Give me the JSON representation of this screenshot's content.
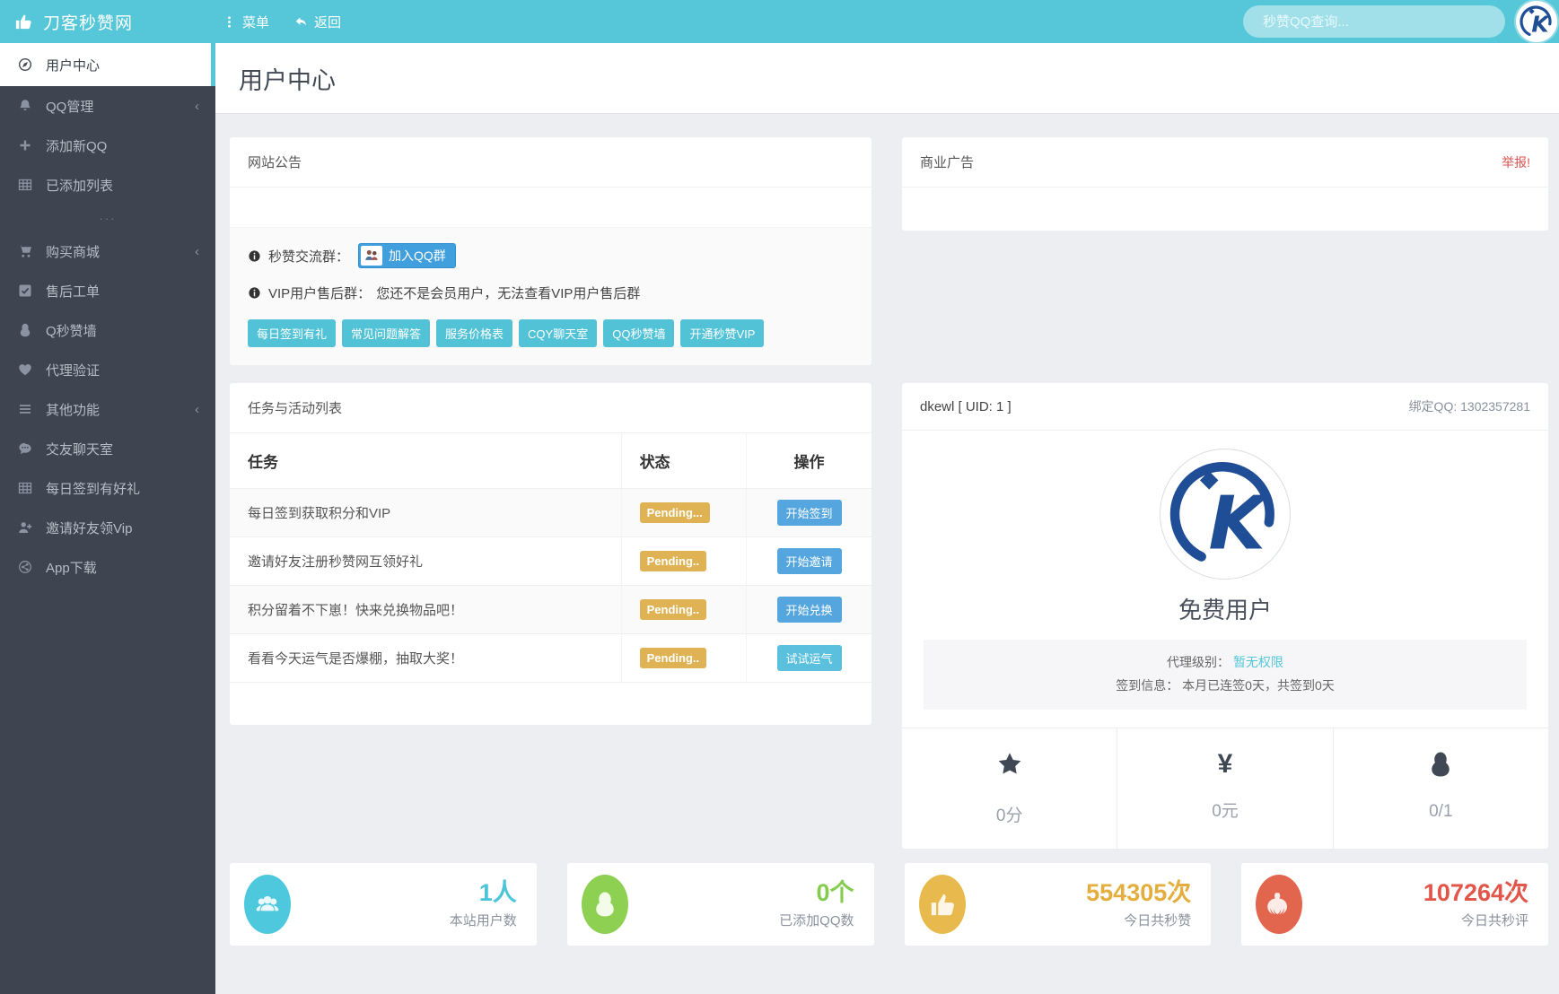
{
  "header": {
    "brand": "刀客秒赞网",
    "nav": [
      {
        "label": "菜单"
      },
      {
        "label": "返回"
      }
    ],
    "search_placeholder": "秒赞QQ查询..."
  },
  "sidebar": {
    "divider_glyph": "···",
    "items": [
      {
        "label": "用户中心",
        "icon": "compass-icon",
        "active": true
      },
      {
        "label": "QQ管理",
        "icon": "bell-icon",
        "chevron": "‹"
      },
      {
        "label": "添加新QQ",
        "icon": "plus-icon"
      },
      {
        "label": "已添加列表",
        "icon": "table-icon"
      },
      {
        "label": "购买商城",
        "icon": "cart-icon",
        "chevron": "‹"
      },
      {
        "label": "售后工单",
        "icon": "check-square-icon"
      },
      {
        "label": "Q秒赞墙",
        "icon": "qq-icon"
      },
      {
        "label": "代理验证",
        "icon": "heart-icon"
      },
      {
        "label": "其他功能",
        "icon": "list-icon",
        "chevron": "‹"
      },
      {
        "label": "交友聊天室",
        "icon": "comment-icon"
      },
      {
        "label": "每日签到有好礼",
        "icon": "table-icon"
      },
      {
        "label": "邀请好友领Vip",
        "icon": "user-plus-icon"
      },
      {
        "label": "App下载",
        "icon": "share-icon"
      }
    ]
  },
  "page": {
    "title": "用户中心"
  },
  "announcement": {
    "title": "网站公告",
    "group_label": "秒赞交流群：",
    "group_button": "加入QQ群",
    "vip_label": "VIP用户售后群：",
    "vip_text": "您还不是会员用户，无法查看VIP用户售后群",
    "quick_links": [
      {
        "label": "每日签到有礼"
      },
      {
        "label": "常见问题解答"
      },
      {
        "label": "服务价格表"
      },
      {
        "label": "CQY聊天室"
      },
      {
        "label": "QQ秒赞墙"
      },
      {
        "label": "开通秒赞VIP"
      }
    ]
  },
  "ad": {
    "title": "商业广告",
    "report_link": "举报!"
  },
  "tasks": {
    "title": "任务与活动列表",
    "columns": [
      "任务",
      "状态",
      "操作"
    ],
    "rows": [
      {
        "task": "每日签到获取积分和VIP",
        "status": "Pending...",
        "action": "开始签到",
        "action_style": "primary"
      },
      {
        "task": "邀请好友注册秒赞网互领好礼",
        "status": "Pending..",
        "action": "开始邀请",
        "action_style": "primary"
      },
      {
        "task": "积分留着不下崽！快来兑换物品吧！",
        "status": "Pending..",
        "action": "开始兑换",
        "action_style": "primary"
      },
      {
        "task": "看看今天运气是否爆棚，抽取大奖！",
        "status": "Pending..",
        "action": "试试运气",
        "action_style": "info"
      }
    ]
  },
  "profile": {
    "username": "dkewl [ UID: 1 ]",
    "bound_qq_label": "绑定QQ:",
    "bound_qq": "1302357281",
    "level": "免费用户",
    "agent_label": "代理级别：",
    "agent_value": "暂无权限",
    "sign_label": "签到信息：",
    "sign_value": "本月已连签0天，共签到0天",
    "stats": [
      {
        "icon": "star-icon",
        "value": "0分"
      },
      {
        "icon": "yen-icon",
        "glyph": "¥",
        "value": "0元"
      },
      {
        "icon": "qq-icon",
        "value": "0/1"
      }
    ]
  },
  "summary_cards": [
    {
      "icon": "users-icon",
      "circle_color": "#4ec8dd",
      "value_color": "#4cc4d9",
      "value": "1人",
      "label": "本站用户数"
    },
    {
      "icon": "qq-icon",
      "circle_color": "#8ed052",
      "value_color": "#85cc4e",
      "value": "0个",
      "label": "已添加QQ数"
    },
    {
      "icon": "thumbs-up-icon",
      "circle_color": "#e8b94d",
      "value_color": "#e3ae3d",
      "value": "554305次",
      "label": "今日共秒赞"
    },
    {
      "icon": "rebel-icon",
      "circle_color": "#e2654d",
      "value_color": "#e25549",
      "value": "107264次",
      "label": "今日共秒评"
    }
  ],
  "colors": {
    "header": "#56c7d8",
    "sidebar": "#3e4450",
    "accent": "#56c7d8",
    "warning_badge": "#dfb253",
    "primary_button": "#55a6de",
    "info_button": "#5bc0de",
    "danger_link": "#d9534f"
  }
}
